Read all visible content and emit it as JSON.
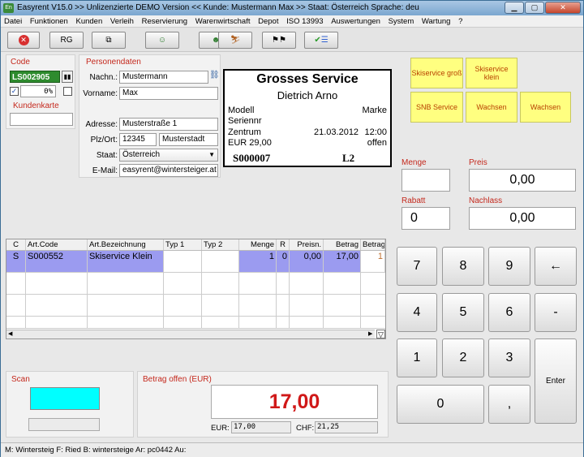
{
  "titlebar": {
    "title": "Easyrent V15.0 >> Unlizenzierte DEMO Version <<   Kunde: Mustermann Max   >> Staat: Österreich Sprache: deu"
  },
  "menu": [
    "Datei",
    "Funktionen",
    "Kunden",
    "Verleih",
    "Reservierung",
    "Warenwirtschaft",
    "Depot",
    "ISO 13993",
    "Auswertungen",
    "System",
    "Wartung",
    "?"
  ],
  "toolbar": {
    "rg_label": "RG"
  },
  "code": {
    "label": "Code",
    "value": "LS002905",
    "pct": "0%",
    "kundenkarte_label": "Kundenkarte"
  },
  "person": {
    "section": "Personendaten",
    "nachname_label": "Nachn.:",
    "nachname": "Mustermann",
    "vorname_label": "Vorname:",
    "vorname": "Max",
    "adresse_label": "Adresse:",
    "adresse": "Musterstraße 1",
    "plz_label": "Plz/Ort:",
    "plz": "12345",
    "ort": "Musterstadt",
    "staat_label": "Staat:",
    "staat": "Österreich",
    "email_label": "E-Mail:",
    "email": "easyrent@wintersteiger.at"
  },
  "ticket": {
    "title": "Grosses Service",
    "name": "Dietrich Arno",
    "modell": "Modell",
    "marke": "Marke",
    "seriennr": "Seriennr",
    "zentrum": "Zentrum",
    "date": "21.03.2012",
    "time": "12:00",
    "price": "EUR  29,00",
    "status": "offen",
    "number": "S000007",
    "code": "L2"
  },
  "service_buttons": [
    "Skiservice groß",
    "Skiservice klein",
    "SNB Service",
    "Wachsen",
    "Wachsen"
  ],
  "fields": {
    "menge_label": "Menge",
    "preis_label": "Preis",
    "preis": "0,00",
    "rabatt_label": "Rabatt",
    "rabatt": "0",
    "nachlass_label": "Nachlass",
    "nachlass": "0,00"
  },
  "table": {
    "columns": [
      "C",
      "Art.Code",
      "Art.Bezeichnung",
      "Typ 1",
      "Typ 2",
      "Menge",
      "R",
      "Preisn.",
      "Betrag",
      "Betrag"
    ],
    "rows": [
      [
        "S",
        "S000552",
        "Skiservice Klein",
        "",
        "",
        "1",
        "0",
        "0,00",
        "17,00",
        "1"
      ]
    ]
  },
  "keypad": {
    "keys": [
      "7",
      "8",
      "9",
      "←",
      "4",
      "5",
      "6",
      "-",
      "1",
      "2",
      "3",
      "0",
      ","
    ],
    "enter": "Enter"
  },
  "scan": {
    "label": "Scan"
  },
  "betrag": {
    "label": "Betrag offen (EUR)",
    "value": "17,00",
    "eur_label": "EUR:",
    "eur": "17,00",
    "chf_label": "CHF:",
    "chf": "21,25"
  },
  "status": "M: Wintersteig F: Ried B: wintersteige Ar: pc0442 Au:",
  "colors": {
    "code_bg": "#2e8b2e",
    "accent_red": "#c4281c",
    "selected_row": "#9b9bf0",
    "scan_bg": "#00ffff",
    "yellow": "#ffff80"
  }
}
